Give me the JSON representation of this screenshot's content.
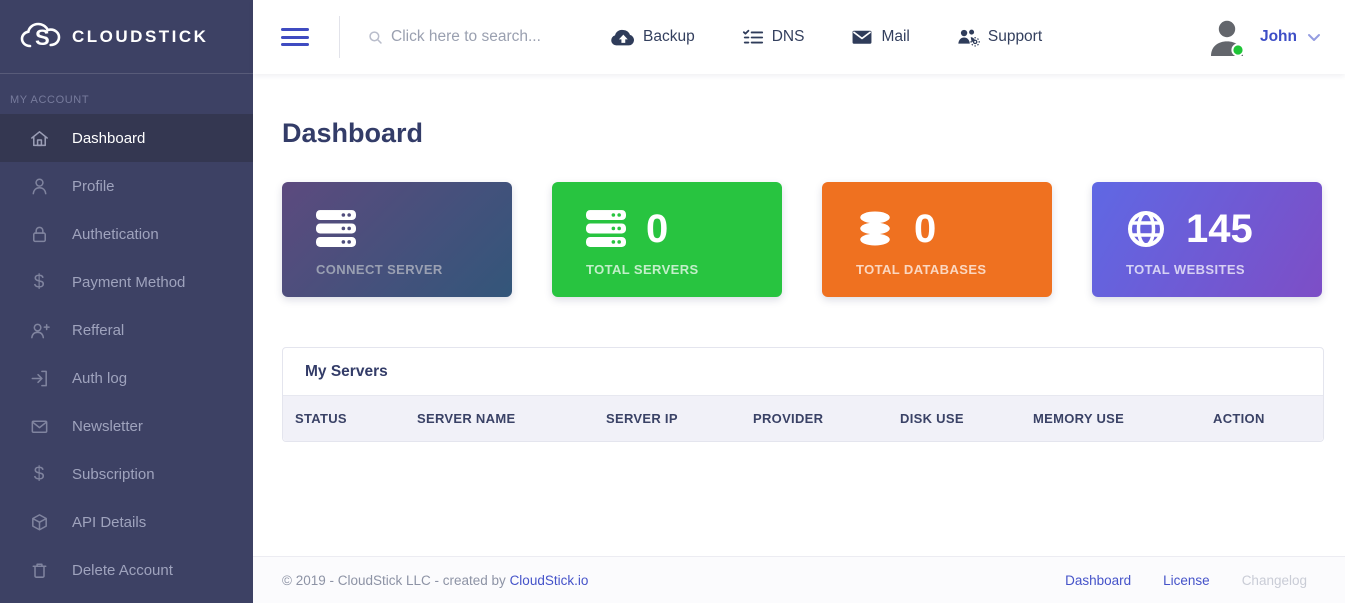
{
  "brand": {
    "name": "CLOUDSTICK"
  },
  "sidebar": {
    "section_label": "MY ACCOUNT",
    "items": [
      {
        "label": "Dashboard",
        "icon": "home-icon",
        "active": true
      },
      {
        "label": "Profile",
        "icon": "user-icon",
        "active": false
      },
      {
        "label": "Authetication",
        "icon": "lock-icon",
        "active": false
      },
      {
        "label": "Payment Method",
        "icon": "dollar-icon",
        "active": false
      },
      {
        "label": "Refferal",
        "icon": "user-plus-icon",
        "active": false
      },
      {
        "label": "Auth log",
        "icon": "login-icon",
        "active": false
      },
      {
        "label": "Newsletter",
        "icon": "envelope-icon",
        "active": false
      },
      {
        "label": "Subscription",
        "icon": "dollar-icon",
        "active": false
      },
      {
        "label": "API Details",
        "icon": "package-icon",
        "active": false
      },
      {
        "label": "Delete Account",
        "icon": "trash-icon",
        "active": false
      }
    ]
  },
  "header": {
    "search_placeholder": "Click here to search...",
    "nav": [
      {
        "label": "Backup",
        "icon": "cloud-upload-icon"
      },
      {
        "label": "DNS",
        "icon": "dns-checklist-icon"
      },
      {
        "label": "Mail",
        "icon": "mail-icon"
      },
      {
        "label": "Support",
        "icon": "support-users-icon"
      }
    ],
    "user": {
      "name": "John",
      "status": "online"
    }
  },
  "page": {
    "title": "Dashboard"
  },
  "stat_cards": [
    {
      "label": "CONNECT SERVER",
      "value": "",
      "icon": "server-stack-icon",
      "bg": "gradient #5c4a7e → #33567a"
    },
    {
      "label": "TOTAL SERVERS",
      "value": "0",
      "icon": "server-stack-icon",
      "bg": "#28c440"
    },
    {
      "label": "TOTAL DATABASES",
      "value": "0",
      "icon": "database-icon",
      "bg": "#ef7120"
    },
    {
      "label": "TOTAL WEBSITES",
      "value": "145",
      "icon": "globe-icon",
      "bg": "gradient #5f68e4 → #7d4ec6"
    }
  ],
  "servers_panel": {
    "title": "My Servers",
    "columns": [
      "STATUS",
      "SERVER NAME",
      "SERVER IP",
      "PROVIDER",
      "DISK USE",
      "MEMORY USE",
      "ACTION"
    ],
    "rows": []
  },
  "footer": {
    "copyright_prefix": "© 2019 - CloudStick LLC - created by ",
    "credit_link": "CloudStick.io",
    "links": [
      {
        "label": "Dashboard",
        "muted": false
      },
      {
        "label": "License",
        "muted": false
      },
      {
        "label": "Changelog",
        "muted": true
      }
    ]
  },
  "colors": {
    "accent_indigo": "#3f4bc1",
    "sidebar_bg": "#3d4164",
    "sidebar_active_bg": "#343751",
    "card_green": "#28c440",
    "card_orange": "#ef7120",
    "card_dark_gradient": [
      "#5c4a7e",
      "#33567a"
    ],
    "card_purple_gradient": [
      "#5f68e4",
      "#7d4ec6"
    ],
    "link_blue": "#4553c9",
    "status_dot_green": "#1fc537"
  }
}
